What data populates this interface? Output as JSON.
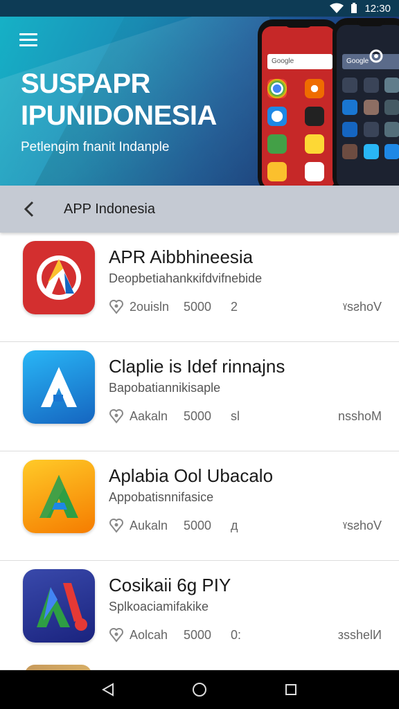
{
  "status_bar": {
    "time": "12:30"
  },
  "hero": {
    "title": "SUSPAPR IPUNIDONESIA",
    "subtitle": "Petlengim fnanit Indanple",
    "phone_a_search": "Google",
    "phone_b_search": "Google"
  },
  "toolbar": {
    "title": "APP Indonesia"
  },
  "apps": [
    {
      "title": "APR Aibbhineesia",
      "desc": "Deopbetiahankĸifdvifnebide",
      "meta_a": "2ouisln",
      "meta_b": "5000",
      "meta_c": "2",
      "meta_d": "ˠsƨhoV",
      "icon": "red-a-icon",
      "colors": [
        "#d32f2f",
        "#ffffff"
      ]
    },
    {
      "title": "Claplie is Idef rinnajns",
      "desc": "Bapobatiannikisaple",
      "meta_a": "Aakaln",
      "meta_b": "5000",
      "meta_c": "ѕl",
      "meta_d": "nsѕhoM",
      "icon": "blue-a-icon",
      "colors": [
        "#1e9be0",
        "#ffffff"
      ]
    },
    {
      "title": "Aplabia Ool Ubacalo",
      "desc": "Appobatisnnifasice",
      "meta_a": "Aukaln",
      "meta_b": "5000",
      "meta_c": "д",
      "meta_d": "ˠsƨhoV",
      "icon": "yellow-a-icon",
      "colors": [
        "#f9b10f",
        "#2e9e44"
      ]
    },
    {
      "title": "Cosikaii 6g PIY",
      "desc": "Splkoaciamifakike",
      "meta_a": "Aolcah",
      "meta_b": "5000",
      "meta_c": "0:",
      "meta_d": "зsshelИ",
      "icon": "navy-a-icon",
      "colors": [
        "#2b3f93",
        "#e53935"
      ]
    }
  ],
  "nav": {
    "back": "back-icon",
    "home": "home-icon",
    "recents": "recents-icon"
  }
}
